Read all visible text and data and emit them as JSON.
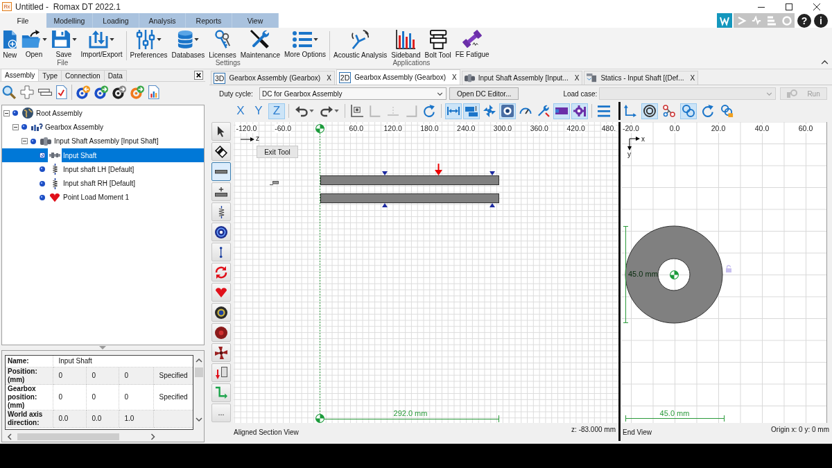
{
  "window": {
    "app_icon": "Rx",
    "title": "Untitled -  Romax DT 2022.1"
  },
  "quick_access": [
    {
      "disabled": false
    },
    {
      "disabled": true
    },
    {
      "disabled": true
    },
    {
      "disabled": true
    },
    {
      "disabled": true
    }
  ],
  "help_button": "?",
  "info_button": "i",
  "ribbon": {
    "tabs": [
      {
        "label": "File",
        "selected": true
      },
      {
        "label": "Modelling",
        "selected": false
      },
      {
        "label": "Loading",
        "selected": false
      },
      {
        "label": "Analysis",
        "selected": false
      },
      {
        "label": "Reports",
        "selected": false
      },
      {
        "label": "View",
        "selected": false
      }
    ],
    "groups": [
      {
        "label": "File",
        "buttons": [
          {
            "label": "New",
            "dropdown": false
          },
          {
            "label": "Open",
            "dropdown": true
          },
          {
            "label": "Save",
            "dropdown": true
          },
          {
            "label": "Import/Export",
            "dropdown": true
          }
        ]
      },
      {
        "label": "Settings",
        "buttons": [
          {
            "label": "Preferences",
            "dropdown": true
          },
          {
            "label": "Databases",
            "dropdown": true
          },
          {
            "label": "Licenses",
            "dropdown": false
          },
          {
            "label": "Maintenance",
            "dropdown": false
          },
          {
            "label": "More Options",
            "dropdown": true
          }
        ]
      },
      {
        "label": "Applications",
        "buttons": [
          {
            "label": "Acoustic Analysis",
            "dropdown": false
          },
          {
            "label": "Sideband",
            "dropdown": false
          },
          {
            "label": "Bolt Tool",
            "dropdown": false
          },
          {
            "label": "FE Fatigue",
            "dropdown": false
          }
        ]
      }
    ]
  },
  "assembly_panel": {
    "tabs": [
      {
        "label": "Assembly",
        "selected": true
      },
      {
        "label": "Type",
        "selected": false
      },
      {
        "label": "Connection",
        "selected": false
      },
      {
        "label": "Data",
        "selected": false
      }
    ],
    "tree": [
      {
        "label": "Root Assembly",
        "kind": "root",
        "expanded": true,
        "selected": false,
        "children": [
          {
            "label": "Gearbox Assembly",
            "kind": "gearbox",
            "expanded": true,
            "selected": false,
            "children": [
              {
                "label": "Input Shaft Assembly [Input Shaft]",
                "kind": "shaft_assembly",
                "expanded": true,
                "selected": false,
                "children": [
                  {
                    "label": "Input Shaft",
                    "kind": "shaft",
                    "selected": true
                  },
                  {
                    "label": "Input shaft LH [Default]",
                    "kind": "bearing",
                    "selected": false
                  },
                  {
                    "label": "Input shaft RH [Default]",
                    "kind": "bearing",
                    "selected": false
                  },
                  {
                    "label": "Point Load Moment 1",
                    "kind": "load",
                    "selected": false
                  }
                ]
              }
            ]
          }
        ]
      }
    ],
    "properties": [
      {
        "label": "Name:",
        "values": [
          "Input Shaft"
        ]
      },
      {
        "label": "Position: (mm)",
        "values": [
          "0",
          "0",
          "0",
          "Specified"
        ]
      },
      {
        "label": "Gearbox position: (mm)",
        "values": [
          "0",
          "0",
          "0",
          "Specified"
        ]
      },
      {
        "label": "World axis direction:",
        "values": [
          "0.0",
          "0.0",
          "1.0"
        ]
      }
    ]
  },
  "documents": [
    {
      "kind": "badge",
      "badge": "3D",
      "label": "Gearbox Assembly (Gearbox)",
      "close": "X",
      "selected": false
    },
    {
      "kind": "badge",
      "badge": "2D",
      "label": "Gearbox Assembly (Gearbox)",
      "close": "X",
      "selected": true
    },
    {
      "kind": "assembly",
      "label": "Input Shaft Assembly [Input...",
      "close": "X",
      "selected": false
    },
    {
      "kind": "statics",
      "label": "Statics - Input Shaft [(Def...",
      "close": "X",
      "selected": false
    }
  ],
  "duty_cycle": {
    "label": "Duty cycle:",
    "value": "DC for Gearbox Assembly"
  },
  "dc_editor_button": "Open DC Editor...",
  "load_case": {
    "label": "Load case:",
    "disabled": true
  },
  "run_button": {
    "label": "Run",
    "disabled": true
  },
  "section_toolbar": [
    [
      {
        "label": "X",
        "selected": false,
        "disabled": false
      },
      {
        "label": "Y",
        "selected": false,
        "disabled": false
      },
      {
        "label": "Z",
        "selected": true,
        "disabled": false
      }
    ],
    [
      {
        "selected": false,
        "disabled": false,
        "dropdown": true
      },
      {
        "selected": false,
        "disabled": false,
        "dropdown": true
      }
    ],
    [
      {
        "selected": false,
        "disabled": false
      },
      {
        "selected": false,
        "disabled": true
      },
      {
        "selected": false,
        "disabled": true
      },
      {
        "selected": false,
        "disabled": true
      },
      {
        "selected": false,
        "disabled": false
      }
    ],
    [
      {
        "selected": true,
        "disabled": false
      },
      {
        "selected": true,
        "disabled": false
      },
      {
        "selected": false,
        "disabled": false
      },
      {
        "selected": true,
        "disabled": false
      },
      {
        "selected": false,
        "disabled": false
      },
      {
        "selected": false,
        "disabled": false
      },
      {
        "selected": true,
        "disabled": false
      },
      {
        "selected": true,
        "disabled": false
      }
    ],
    [
      {
        "selected": false,
        "disabled": false
      }
    ]
  ],
  "end_toolbar": [
    {
      "selected": false
    },
    {
      "selected": true
    },
    {
      "selected": false
    },
    {
      "selected": true
    },
    {
      "selected": false
    },
    {
      "selected": false
    }
  ],
  "tool_strip": [
    {
      "selected": false
    },
    {
      "selected": false
    },
    {
      "selected": true
    },
    {
      "selected": false
    },
    {
      "selected": false
    },
    {
      "selected": false
    },
    {
      "selected": false
    },
    {
      "selected": false
    },
    {
      "selected": false
    },
    {
      "selected": false
    },
    {
      "selected": false
    },
    {
      "selected": false
    },
    {
      "selected": false
    },
    {
      "selected": false
    },
    {
      "label": "...",
      "selected": false
    }
  ],
  "section_view": {
    "ruler": [
      "-120.0",
      "-60.0",
      "60.0",
      "120.0",
      "180.0",
      "240.0",
      "300.0",
      "360.0",
      "420.0",
      "480."
    ],
    "axis_label": "z",
    "exit_tool_button": "Exit Tool",
    "dimension": "292.0 mm",
    "view_name": "Aligned Section View",
    "cursor_readout": "z: -83.000 mm"
  },
  "end_view": {
    "ruler": [
      "-20.0",
      "0.0",
      "20.0",
      "40.0",
      "60.0"
    ],
    "axis_labels": [
      "x",
      "y"
    ],
    "height_dimension": "45.0 mm",
    "width_dimension": "45.0 mm",
    "view_name": "End View",
    "origin_readout": "Origin x: 0 y: 0 mm"
  }
}
